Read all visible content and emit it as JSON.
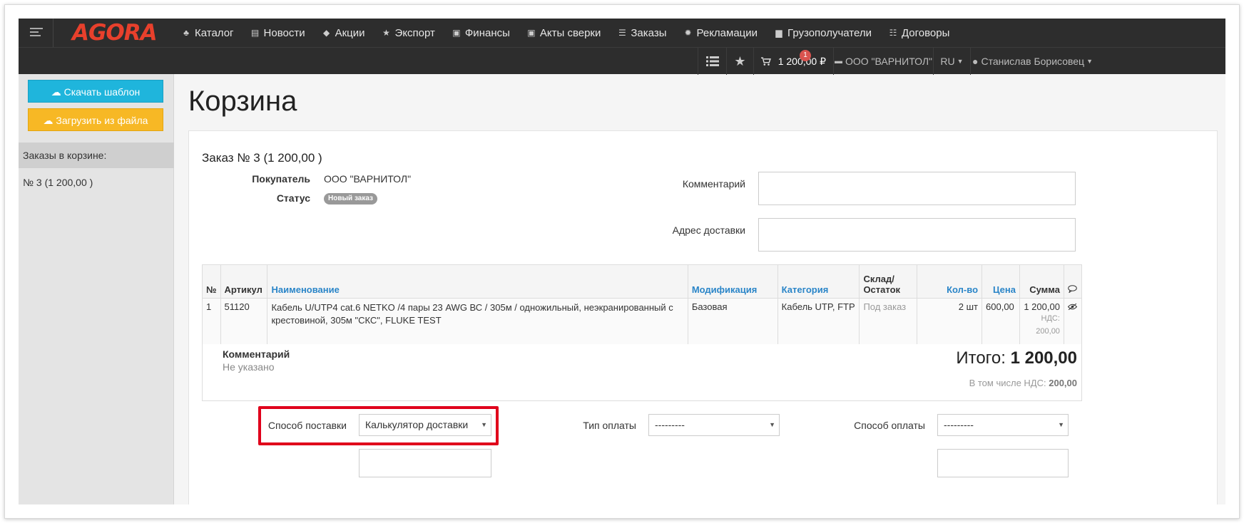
{
  "nav": {
    "logo": "AGORA",
    "menu": [
      {
        "icon": "sitemap-icon",
        "glyph": "♣",
        "label": "Каталог"
      },
      {
        "icon": "document-icon",
        "glyph": "▤",
        "label": "Новости"
      },
      {
        "icon": "tags-icon",
        "glyph": "◆",
        "label": "Акции"
      },
      {
        "icon": "star-icon",
        "glyph": "★",
        "label": "Экспорт"
      },
      {
        "icon": "money-icon",
        "glyph": "▣",
        "label": "Финансы"
      },
      {
        "icon": "money-icon",
        "glyph": "▣",
        "label": "Акты сверки"
      },
      {
        "icon": "list-icon",
        "glyph": "☰",
        "label": "Заказы"
      },
      {
        "icon": "gear-icon",
        "glyph": "✹",
        "label": "Рекламации"
      },
      {
        "icon": "archive-icon",
        "glyph": "▆",
        "label": "Грузополучатели"
      },
      {
        "icon": "list-alt-icon",
        "glyph": "☷",
        "label": "Договоры"
      }
    ],
    "cart_count": "1",
    "cart_total": "1 200,00 ₽",
    "company": "ООО \"ВАРНИТОЛ\"",
    "language": "RU",
    "user": "Станислав Борисовец"
  },
  "sidebar": {
    "download_template": "Скачать шаблон",
    "upload_file": "Загрузить из файла",
    "orders_header": "Заказы в корзине:",
    "orders": [
      "№ 3 (1 200,00 )"
    ]
  },
  "main": {
    "title": "Корзина",
    "order": {
      "title": "Заказ № 3 (1 200,00 )",
      "buyer_label": "Покупатель",
      "buyer": "ООО \"ВАРНИТОЛ\"",
      "status_label": "Статус",
      "status": "Новый заказ",
      "comment_label": "Комментарий",
      "comment_value": "",
      "address_label": "Адрес доставки",
      "address_value": ""
    },
    "table": {
      "headers": [
        "№",
        "Артикул",
        "Наименование",
        "Модификация",
        "Категория",
        "Склад/ Остаток",
        "Кол-во",
        "Цена",
        "Сумма"
      ],
      "rows": [
        {
          "num": "1",
          "article": "51120",
          "name": "Кабель U/UTP4 cat.6 NETKO /4 пары 23 AWG ВС / 305м / одножильный, неэкранированный с крестовиной, 305м \"СКС\", FLUKE TEST",
          "modification": "Базовая",
          "category": "Кабель UTP, FTP",
          "stock": "Под заказ",
          "qty": "2 шт",
          "price": "600,00",
          "sum": "1 200,00",
          "vat": "НДС: 200,00"
        }
      ]
    },
    "summary": {
      "comment_label": "Комментарий",
      "comment_value": "Не указано",
      "total_label": "Итого:",
      "total_value": "1 200,00",
      "vat_label": "В том числе НДС:",
      "vat_value": "200,00"
    },
    "delivery": {
      "method_label": "Способ поставки",
      "method_value": "Калькулятор доставки",
      "payment_type_label": "Тип оплаты",
      "payment_type_value": "---------",
      "payment_method_label": "Способ оплаты",
      "payment_method_value": "---------"
    }
  },
  "colors": {
    "navbar": "#2d2d2d",
    "accent_blue": "#1fb5dc",
    "accent_yellow": "#f7b825",
    "logo_red": "#e8402c",
    "highlight_red": "#e0001b",
    "link_blue": "#2a85c8"
  }
}
